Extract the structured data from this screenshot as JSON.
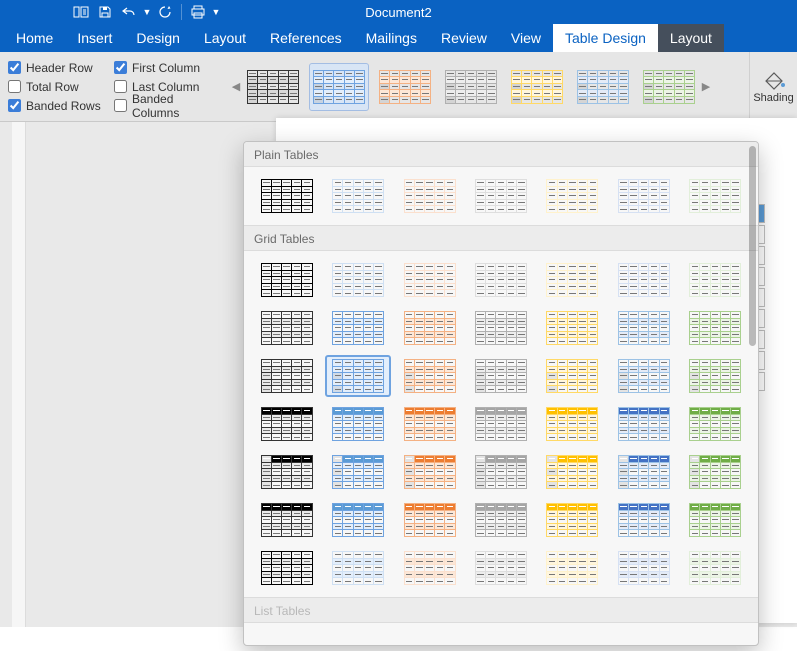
{
  "title": "Document2",
  "tabs": [
    "Home",
    "Insert",
    "Design",
    "Layout",
    "References",
    "Mailings",
    "Review",
    "View",
    "Table Design",
    "Layout"
  ],
  "active_tab": "Table Design",
  "options": {
    "header_row": {
      "label": "Header Row",
      "checked": true
    },
    "total_row": {
      "label": "Total Row",
      "checked": false
    },
    "banded_rows": {
      "label": "Banded Rows",
      "checked": true
    },
    "first_column": {
      "label": "First Column",
      "checked": true
    },
    "last_column": {
      "label": "Last Column",
      "checked": false
    },
    "banded_columns": {
      "label": "Banded Columns",
      "checked": false
    }
  },
  "shading_label": "Shading",
  "gallery_sections": {
    "plain": "Plain Tables",
    "grid": "Grid Tables",
    "list": "List Tables"
  },
  "accent_colors": [
    "#000000",
    "#5b9bd5",
    "#ed7d31",
    "#a5a5a5",
    "#ffc000",
    "#4472c4",
    "#70ad47"
  ]
}
